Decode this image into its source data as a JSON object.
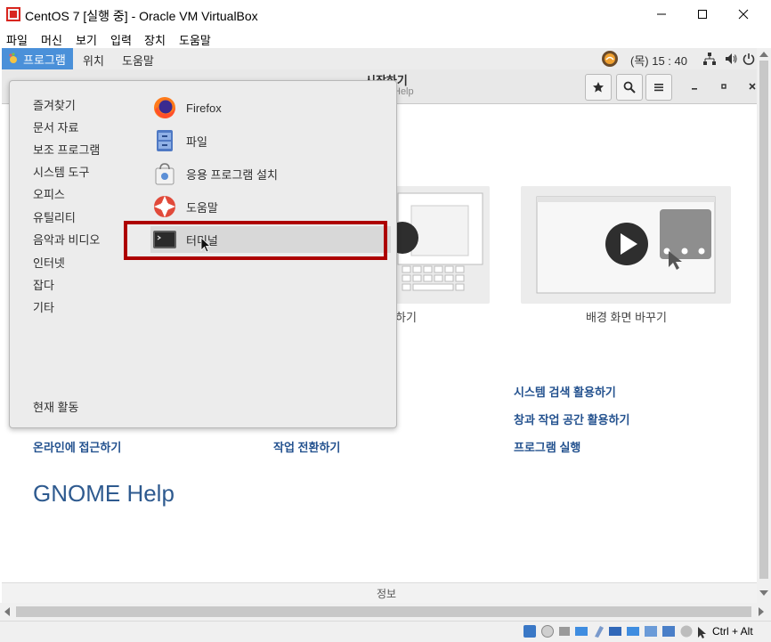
{
  "window": {
    "title": "CentOS 7 [실행 중] - Oracle VM VirtualBox",
    "controls": {
      "minimize": "—",
      "maximize": "☐",
      "close": "✕"
    }
  },
  "vbox_menu": [
    "파일",
    "머신",
    "보기",
    "입력",
    "장치",
    "도움말"
  ],
  "topbar": {
    "apps_label": "프로그램",
    "places_label": "위치",
    "app_label": "도움말",
    "clock": "(목) 15 : 40"
  },
  "help": {
    "header_title": "시작하기",
    "header_subtitle": "Help",
    "card1_caption": "하기",
    "card2_caption": "배경 화면 바꾸기",
    "links_right": [
      "시스템 검색 활용하기",
      "창과 작업 공간 활용하기",
      "프로그램 실행"
    ],
    "links_bottom": [
      "온라인에 접근하기",
      "작업 전환하기"
    ],
    "footer_title": "GNOME Help",
    "status": "정보"
  },
  "apps_popup": {
    "categories": [
      "즐겨찾기",
      "문서 자료",
      "보조 프로그램",
      "시스템 도구",
      "오피스",
      "유틸리티",
      "음악과 비디오",
      "인터넷",
      "잡다",
      "기타"
    ],
    "activities": "현재 활동",
    "apps": [
      "Firefox",
      "파일",
      "응용 프로그램 설치",
      "도움말",
      "터미널"
    ]
  },
  "host_key": "Ctrl + Alt",
  "colors": {
    "accent": "#4a90d9",
    "highlight": "#ad0000",
    "link": "#24528f"
  }
}
